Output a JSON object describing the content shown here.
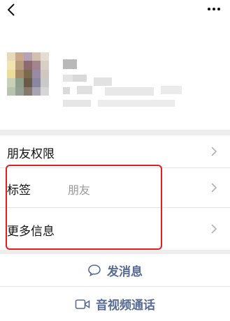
{
  "header": {
    "back_icon": "chevron-left-icon",
    "more_icon": "more-dots-icon"
  },
  "profile": {
    "avatar_state": "pixelated",
    "name_state": "pixelated"
  },
  "rows": [
    {
      "label": "朋友权限",
      "value": ""
    },
    {
      "label": "标签",
      "value": "朋友"
    },
    {
      "label": "更多信息",
      "value": ""
    }
  ],
  "actions": {
    "send_message": "发消息",
    "av_call": "音视频通话"
  },
  "colors": {
    "link": "#576b95",
    "highlight": "#e02020",
    "page_bg": "#ededed"
  }
}
